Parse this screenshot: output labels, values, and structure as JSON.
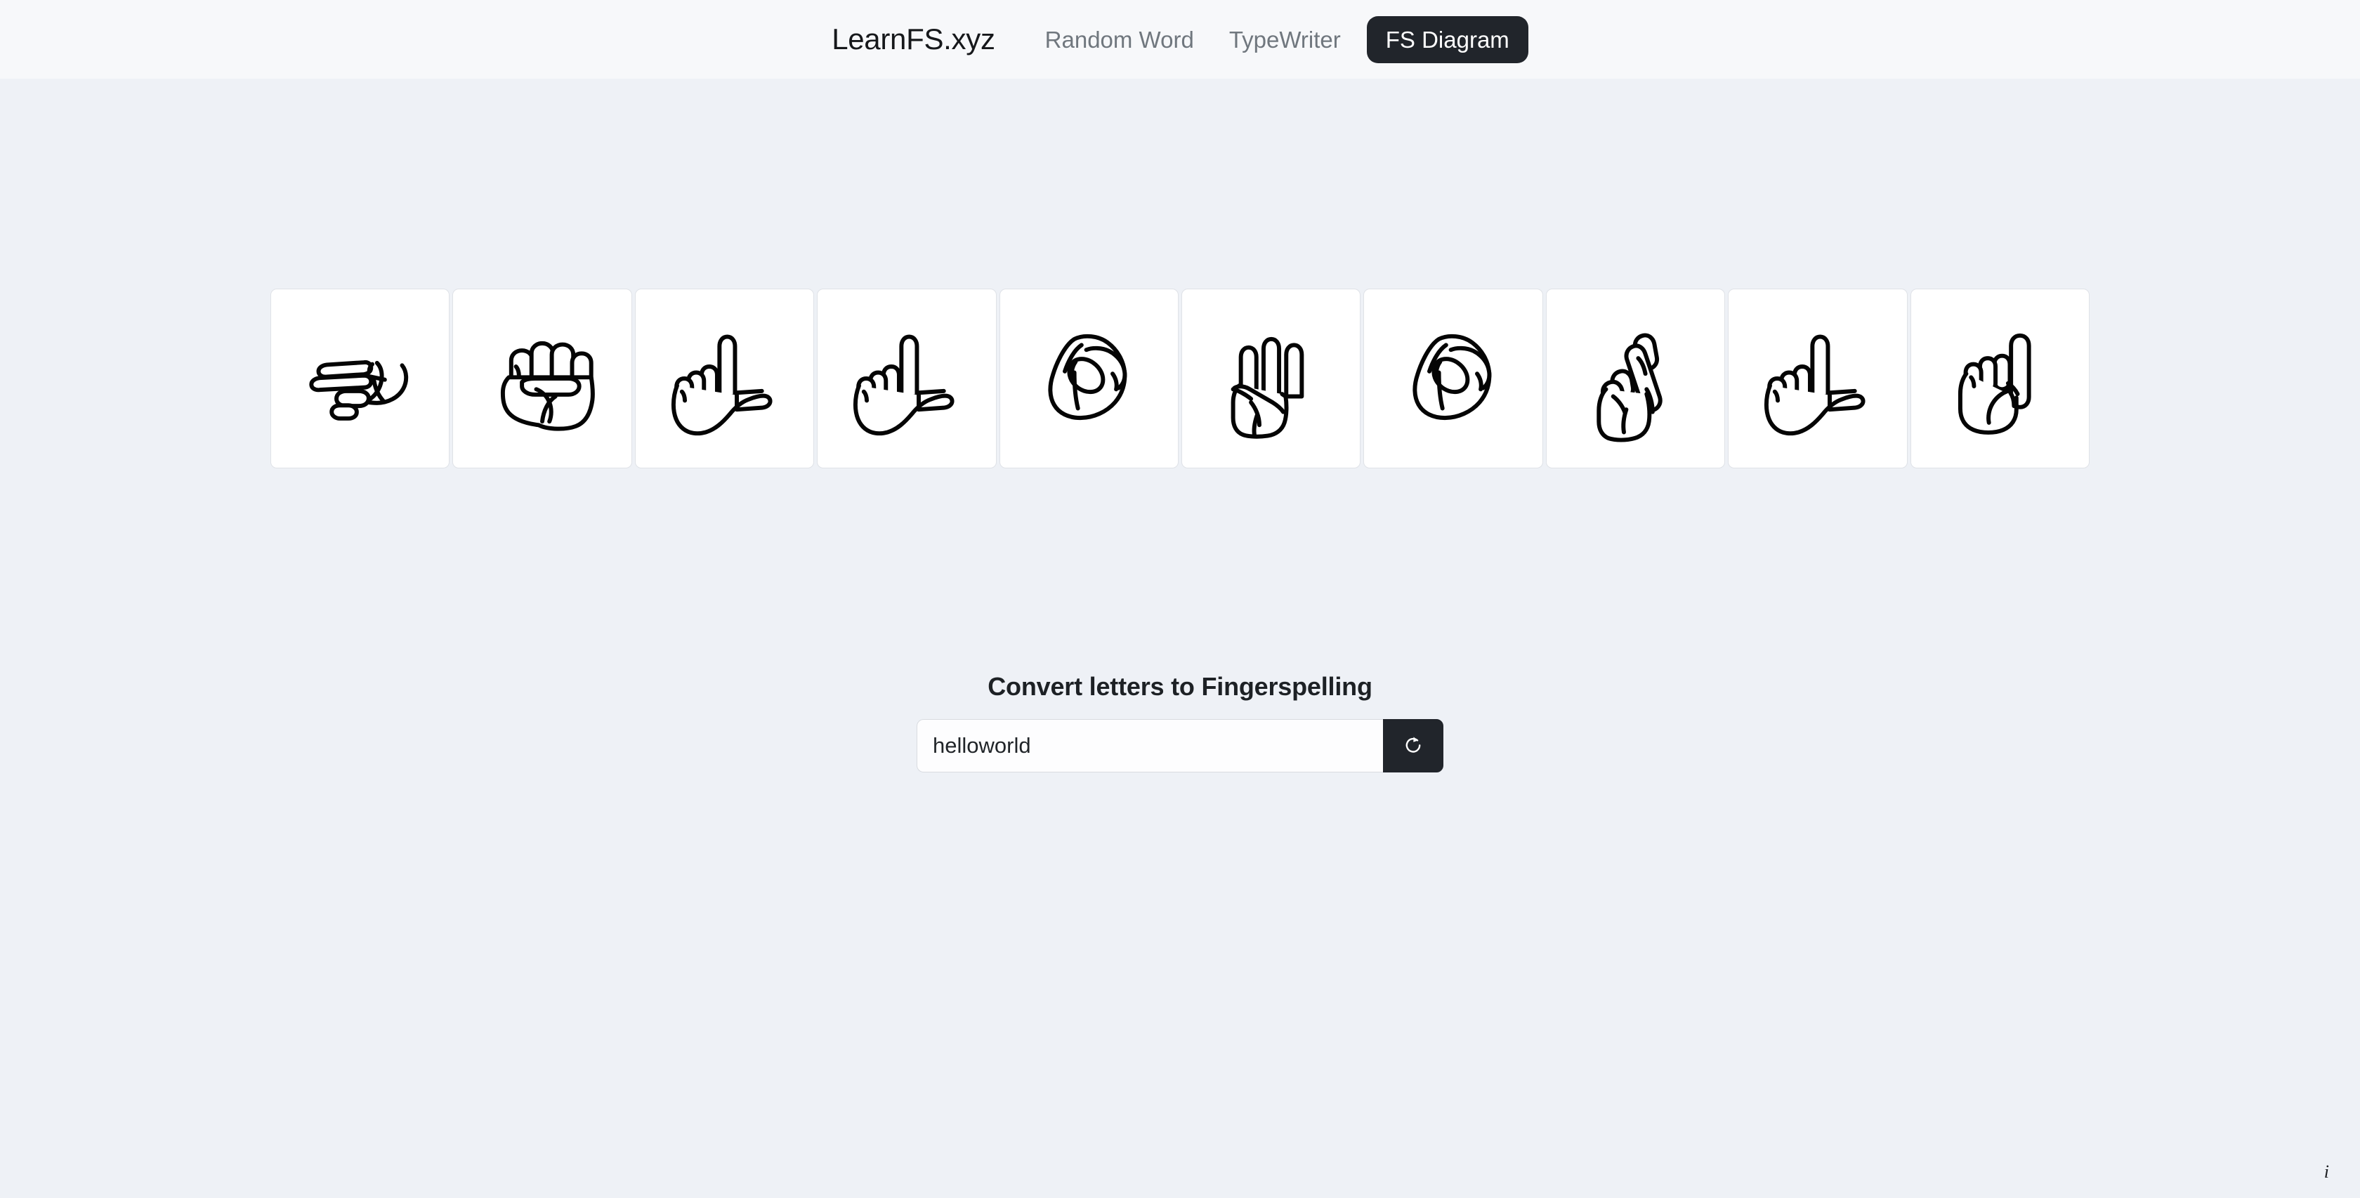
{
  "header": {
    "brand": "LearnFS.xyz",
    "nav": [
      {
        "label": "Random Word",
        "active": false
      },
      {
        "label": "TypeWriter",
        "active": false
      },
      {
        "label": "FS Diagram",
        "active": true
      }
    ],
    "background_color": "#f7f8fa",
    "active_tab_bg": "#21252b",
    "inactive_link_color": "#70777e"
  },
  "page": {
    "background_color": "#eef1f6"
  },
  "diagram": {
    "word": "helloworld",
    "letters": [
      "h",
      "e",
      "l",
      "l",
      "o",
      "w",
      "o",
      "r",
      "l",
      "d"
    ],
    "cards": [
      {
        "letter": "h",
        "icon": "asl-hand-h-icon"
      },
      {
        "letter": "e",
        "icon": "asl-hand-e-icon"
      },
      {
        "letter": "l",
        "icon": "asl-hand-l-icon"
      },
      {
        "letter": "l",
        "icon": "asl-hand-l-icon"
      },
      {
        "letter": "o",
        "icon": "asl-hand-o-icon"
      },
      {
        "letter": "w",
        "icon": "asl-hand-w-icon"
      },
      {
        "letter": "o",
        "icon": "asl-hand-o-icon"
      },
      {
        "letter": "r",
        "icon": "asl-hand-r-icon"
      },
      {
        "letter": "l",
        "icon": "asl-hand-l-icon"
      },
      {
        "letter": "d",
        "icon": "asl-hand-d-icon"
      }
    ],
    "card_background": "#ffffff",
    "card_border_color": "#dfe2e7"
  },
  "converter": {
    "heading": "Convert letters to Fingerspelling",
    "input_value": "helloworld",
    "input_placeholder": "",
    "refresh_button_icon": "refresh-icon",
    "refresh_button_bg": "#21252b"
  },
  "footer": {
    "info_marker": "i"
  }
}
